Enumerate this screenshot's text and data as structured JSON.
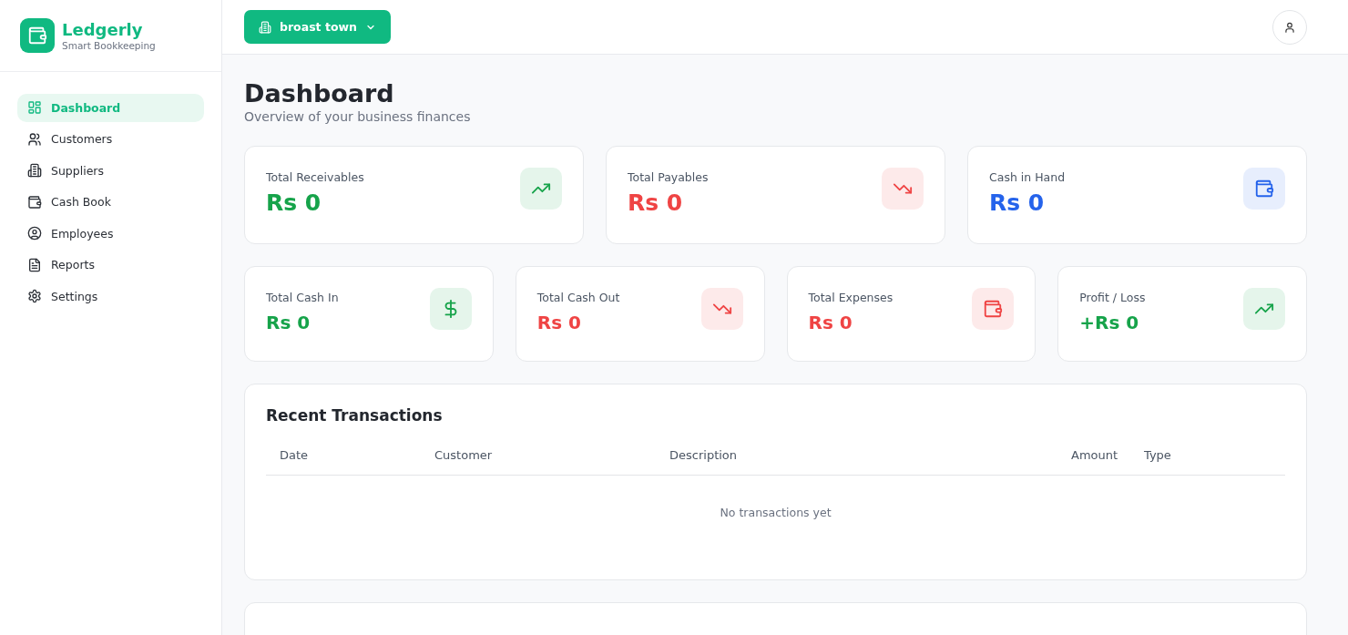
{
  "brand": {
    "name": "Ledgerly",
    "tagline": "Smart Bookkeeping"
  },
  "sidebar": {
    "items": [
      {
        "label": "Dashboard",
        "selected": true
      },
      {
        "label": "Customers",
        "selected": false
      },
      {
        "label": "Suppliers",
        "selected": false
      },
      {
        "label": "Cash Book",
        "selected": false
      },
      {
        "label": "Employees",
        "selected": false
      },
      {
        "label": "Reports",
        "selected": false
      },
      {
        "label": "Settings",
        "selected": false
      }
    ]
  },
  "business_switcher": {
    "label": "broast town"
  },
  "page": {
    "title": "Dashboard",
    "subtitle": "Overview of your business finances"
  },
  "summary_cards": [
    {
      "label": "Total Receivables",
      "value": "Rs 0",
      "color": "#16a34a",
      "kind": "rise"
    },
    {
      "label": "Total Payables",
      "value": "Rs 0",
      "color": "#ef4444",
      "kind": "fall"
    },
    {
      "label": "Cash in Hand",
      "value": "Rs 0",
      "color": "#2563eb",
      "kind": "wallet"
    }
  ],
  "detail_cards": [
    {
      "label": "Total Cash In",
      "value": "Rs 0",
      "color": "#16a34a",
      "kind": "dollar"
    },
    {
      "label": "Total Cash Out",
      "value": "Rs 0",
      "color": "#ef4444",
      "kind": "fall"
    },
    {
      "label": "Total Expenses",
      "value": "Rs 0",
      "color": "#ef4444",
      "kind": "wallet"
    },
    {
      "label": "Profit / Loss",
      "value": "+Rs 0",
      "color": "#16a34a",
      "kind": "rise"
    }
  ],
  "recent_transactions": {
    "title": "Recent Transactions",
    "columns": [
      "Date",
      "Customer",
      "Description",
      "Amount",
      "Type"
    ],
    "empty_message": "No transactions yet"
  }
}
